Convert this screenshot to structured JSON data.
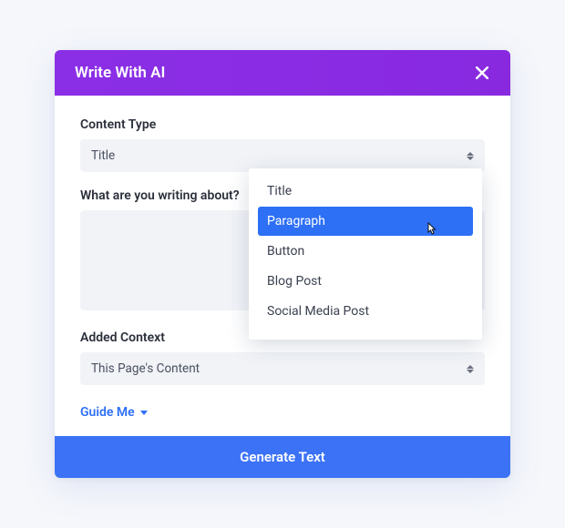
{
  "header": {
    "title": "Write With AI"
  },
  "contentType": {
    "label": "Content Type",
    "value": "Title",
    "options": [
      "Title",
      "Paragraph",
      "Button",
      "Blog Post",
      "Social Media Post"
    ],
    "highlightedIndex": 1
  },
  "about": {
    "label": "What are you writing about?",
    "value": ""
  },
  "addedContext": {
    "label": "Added Context",
    "value": "This Page's Content"
  },
  "guide": {
    "label": "Guide Me"
  },
  "footer": {
    "button": "Generate Text"
  },
  "colors": {
    "headerBg": "#8a2be2",
    "primaryBlue": "#2d6ff5",
    "footerBlue": "#3b72f6",
    "fieldBg": "#f1f3f7"
  }
}
